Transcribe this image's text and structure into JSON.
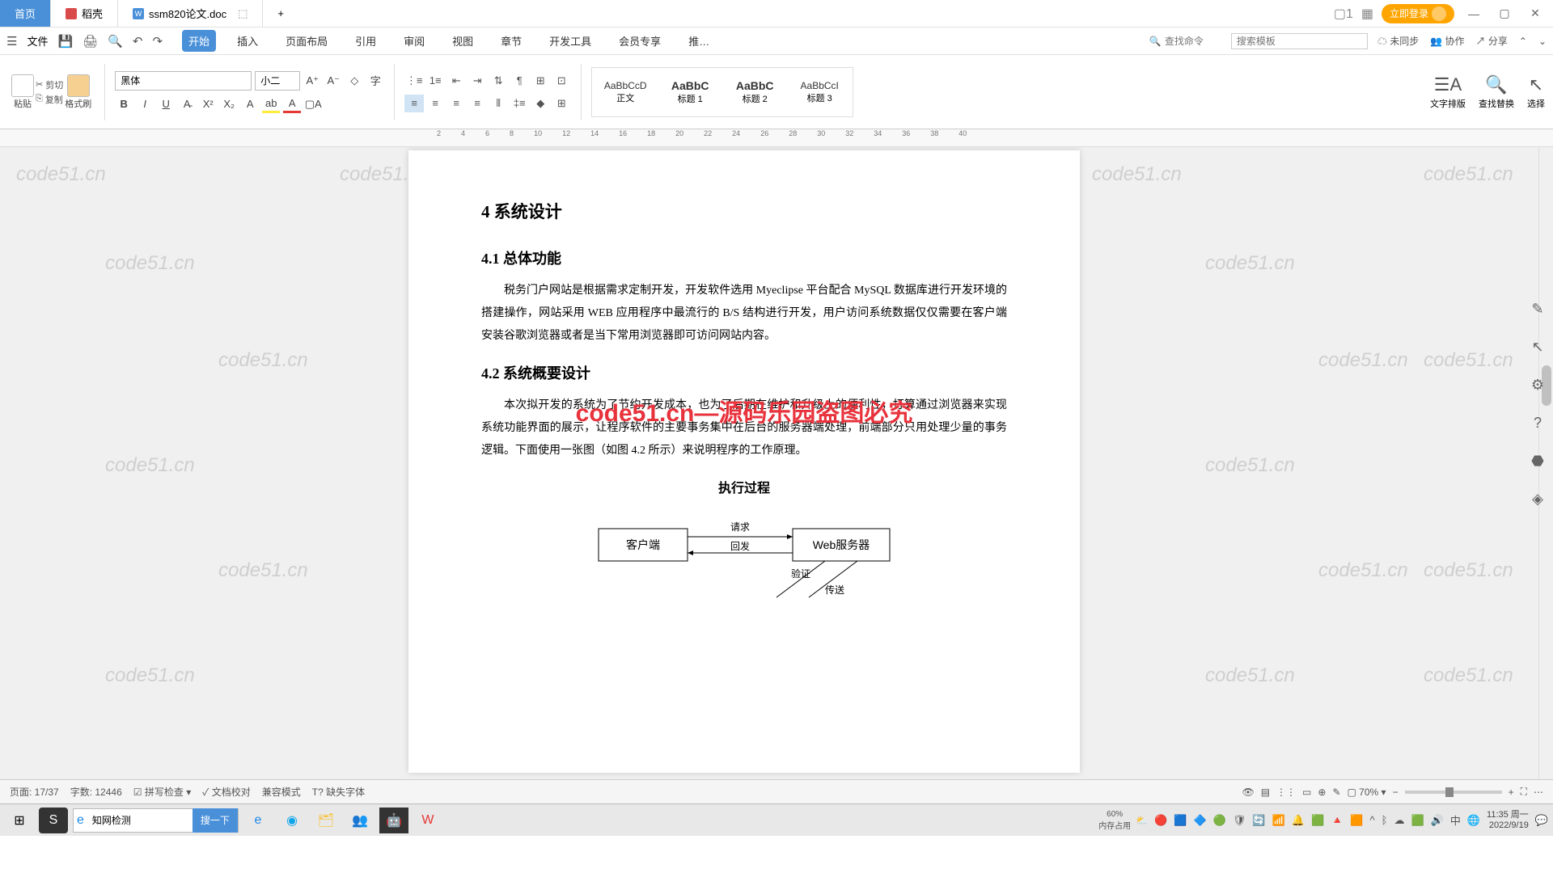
{
  "titlebar": {
    "home_label": "首页",
    "tab1_label": "稻壳",
    "tab2_label": "ssm820论文.doc",
    "login_label": "立即登录"
  },
  "quickbar": {
    "file_label": "文件",
    "menus": [
      "开始",
      "插入",
      "页面布局",
      "引用",
      "审阅",
      "视图",
      "章节",
      "开发工具",
      "会员专享",
      "推…"
    ],
    "search_cmd_placeholder": "查找命令",
    "search_tmpl_placeholder": "搜索模板",
    "unsync": "未同步",
    "coop": "协作",
    "share": "分享"
  },
  "ribbon": {
    "cut": "剪切",
    "copy": "复制",
    "paste": "粘贴",
    "format_painter": "格式刷",
    "font_name": "黑体",
    "font_size": "小二",
    "styles": [
      {
        "preview": "AaBbCcD",
        "label": "正文"
      },
      {
        "preview": "AaBbC",
        "label": "标题 1"
      },
      {
        "preview": "AaBbC",
        "label": "标题 2"
      },
      {
        "preview": "AaBbCcI",
        "label": "标题 3"
      }
    ],
    "text_layout": "文字排版",
    "find_replace": "查找替换",
    "select": "选择"
  },
  "ruler_marks": [
    "2",
    "4",
    "6",
    "8",
    "10",
    "12",
    "14",
    "16",
    "18",
    "20",
    "22",
    "24",
    "26",
    "28",
    "30",
    "32",
    "34",
    "36",
    "38",
    "40"
  ],
  "document": {
    "h1": "4 系统设计",
    "h2a": "4.1 总体功能",
    "p1": "税务门户网站是根据需求定制开发，开发软件选用 Myeclipse 平台配合 MySQL 数据库进行开发环境的搭建操作，网站采用 WEB 应用程序中最流行的 B/S 结构进行开发，用户访问系统数据仅仅需要在客户端安装谷歌浏览器或者是当下常用浏览器即可访问网站内容。",
    "h2b": "4.2 系统概要设计",
    "p2": "本次拟开发的系统为了节约开发成本，也为了后期在维护和升级上的便利性，打算通过浏览器来实现系统功能界面的展示，让程序软件的主要事务集中在后台的服务器端处理，前端部分只用处理少量的事务逻辑。下面使用一张图（如图 4.2 所示）来说明程序的工作原理。",
    "diagram_title": "执行过程",
    "diagram": {
      "client": "客户端",
      "server": "Web服务器",
      "req": "请求",
      "resp": "回发",
      "verify": "验证",
      "send": "传送"
    },
    "watermark_center": "code51.cn—源码乐园盗图必究",
    "watermark_tile": "code51.cn"
  },
  "statusbar": {
    "page": "页面: 17/37",
    "words": "字数: 12446",
    "spell": "拼写检查",
    "doc_check": "文档校对",
    "compat": "兼容模式",
    "missing_font": "缺失字体",
    "zoom": "70%"
  },
  "taskbar": {
    "search_text": "知网检测",
    "search_btn": "搜一下",
    "mem_pct": "60%",
    "mem_label": "内存占用",
    "time": "11:35 周一",
    "date": "2022/9/19"
  }
}
